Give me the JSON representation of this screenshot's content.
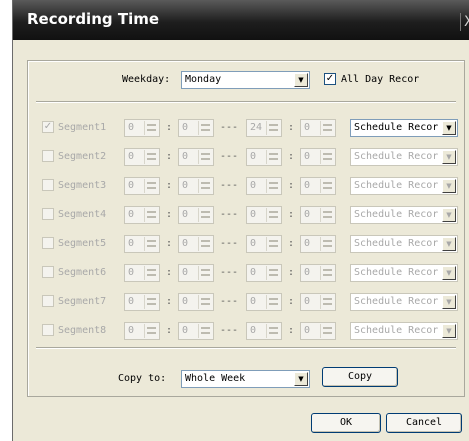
{
  "window": {
    "title": "Recording Time",
    "close_glyph": "X"
  },
  "weekday": {
    "label": "Weekday:",
    "value": "Monday"
  },
  "all_day": {
    "label": "All Day Recor",
    "checked": true
  },
  "segments": [
    {
      "label": "Segment1",
      "checked": true,
      "start_h": "0",
      "start_m": "0",
      "end_h": "24",
      "end_m": "0",
      "type": "Schedule Recor",
      "enabled": true
    },
    {
      "label": "Segment2",
      "checked": false,
      "start_h": "0",
      "start_m": "0",
      "end_h": "0",
      "end_m": "0",
      "type": "Schedule Recor",
      "enabled": false
    },
    {
      "label": "Segment3",
      "checked": false,
      "start_h": "0",
      "start_m": "0",
      "end_h": "0",
      "end_m": "0",
      "type": "Schedule Recor",
      "enabled": false
    },
    {
      "label": "Segment4",
      "checked": false,
      "start_h": "0",
      "start_m": "0",
      "end_h": "0",
      "end_m": "0",
      "type": "Schedule Recor",
      "enabled": false
    },
    {
      "label": "Segment5",
      "checked": false,
      "start_h": "0",
      "start_m": "0",
      "end_h": "0",
      "end_m": "0",
      "type": "Schedule Recor",
      "enabled": false
    },
    {
      "label": "Segment6",
      "checked": false,
      "start_h": "0",
      "start_m": "0",
      "end_h": "0",
      "end_m": "0",
      "type": "Schedule Recor",
      "enabled": false
    },
    {
      "label": "Segment7",
      "checked": false,
      "start_h": "0",
      "start_m": "0",
      "end_h": "0",
      "end_m": "0",
      "type": "Schedule Recor",
      "enabled": false
    },
    {
      "label": "Segment8",
      "checked": false,
      "start_h": "0",
      "start_m": "0",
      "end_h": "0",
      "end_m": "0",
      "type": "Schedule Recor",
      "enabled": false
    }
  ],
  "copy": {
    "label": "Copy to:",
    "value": "Whole Week",
    "button": "Copy"
  },
  "buttons": {
    "ok": "OK",
    "cancel": "Cancel"
  },
  "colors": {
    "title_bar": "#1e1e1e",
    "dialog_bg": "#ece9d8",
    "disabled_text": "#a8a8a8",
    "border_blue": "#7f9db9"
  }
}
